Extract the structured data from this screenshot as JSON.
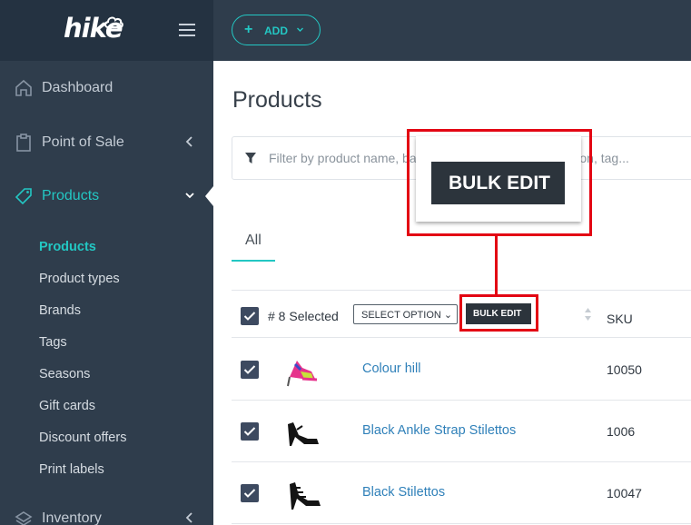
{
  "brand": {
    "logo_text": "hike"
  },
  "sidebar": {
    "items": [
      {
        "label": "Dashboard",
        "icon": "home-icon"
      },
      {
        "label": "Point of Sale",
        "icon": "clipboard-icon"
      },
      {
        "label": "Products",
        "icon": "tag-icon"
      },
      {
        "label": "Inventory",
        "icon": "layers-icon"
      }
    ],
    "products_submenu": [
      "Products",
      "Product types",
      "Brands",
      "Tags",
      "Seasons",
      "Gift cards",
      "Discount offers",
      "Print labels"
    ]
  },
  "topbar": {
    "add_label": "ADD"
  },
  "main": {
    "title": "Products",
    "filter_placeholder": "Filter by product name, barcode, SKU, brand, tag, season, tag...",
    "tabs": [
      {
        "label": "All"
      }
    ]
  },
  "table": {
    "selected_text": "# 8 Selected",
    "select_option_label": "SELECT OPTION",
    "bulk_edit_label": "BULK EDIT",
    "sku_header": "SKU",
    "rows": [
      {
        "name": "Colour hill",
        "sku": "10050",
        "checked": true
      },
      {
        "name": "Black Ankle Strap Stilettos",
        "sku": "1006",
        "checked": true
      },
      {
        "name": "Black Stilettos",
        "sku": "10047",
        "checked": true
      }
    ]
  },
  "callout": {
    "bulk_edit_label": "BULK EDIT"
  },
  "colors": {
    "accent": "#23c7c3",
    "sidebar": "#2f3d4c",
    "highlight": "#e30613",
    "link": "#2f80b9"
  }
}
